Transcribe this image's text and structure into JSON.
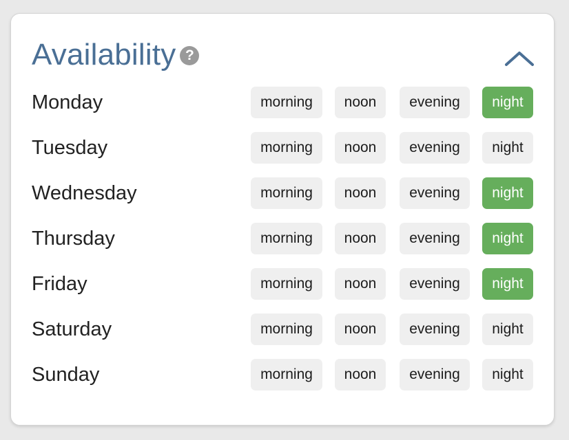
{
  "header": {
    "title": "Availability",
    "help_icon_glyph": "?",
    "help_icon": "question-circle-icon",
    "collapse_icon": "chevron-up-icon"
  },
  "colors": {
    "title": "#4a6f95",
    "selected_slot": "#66ae5c",
    "unselected_slot": "#efefef"
  },
  "days": [
    {
      "label": "Monday",
      "slots": [
        {
          "label": "morning",
          "selected": false
        },
        {
          "label": "noon",
          "selected": false
        },
        {
          "label": "evening",
          "selected": false
        },
        {
          "label": "night",
          "selected": true
        }
      ]
    },
    {
      "label": "Tuesday",
      "slots": [
        {
          "label": "morning",
          "selected": false
        },
        {
          "label": "noon",
          "selected": false
        },
        {
          "label": "evening",
          "selected": false
        },
        {
          "label": "night",
          "selected": false
        }
      ]
    },
    {
      "label": "Wednesday",
      "slots": [
        {
          "label": "morning",
          "selected": false
        },
        {
          "label": "noon",
          "selected": false
        },
        {
          "label": "evening",
          "selected": false
        },
        {
          "label": "night",
          "selected": true
        }
      ]
    },
    {
      "label": "Thursday",
      "slots": [
        {
          "label": "morning",
          "selected": false
        },
        {
          "label": "noon",
          "selected": false
        },
        {
          "label": "evening",
          "selected": false
        },
        {
          "label": "night",
          "selected": true
        }
      ]
    },
    {
      "label": "Friday",
      "slots": [
        {
          "label": "morning",
          "selected": false
        },
        {
          "label": "noon",
          "selected": false
        },
        {
          "label": "evening",
          "selected": false
        },
        {
          "label": "night",
          "selected": true
        }
      ]
    },
    {
      "label": "Saturday",
      "slots": [
        {
          "label": "morning",
          "selected": false
        },
        {
          "label": "noon",
          "selected": false
        },
        {
          "label": "evening",
          "selected": false
        },
        {
          "label": "night",
          "selected": false
        }
      ]
    },
    {
      "label": "Sunday",
      "slots": [
        {
          "label": "morning",
          "selected": false
        },
        {
          "label": "noon",
          "selected": false
        },
        {
          "label": "evening",
          "selected": false
        },
        {
          "label": "night",
          "selected": false
        }
      ]
    }
  ]
}
